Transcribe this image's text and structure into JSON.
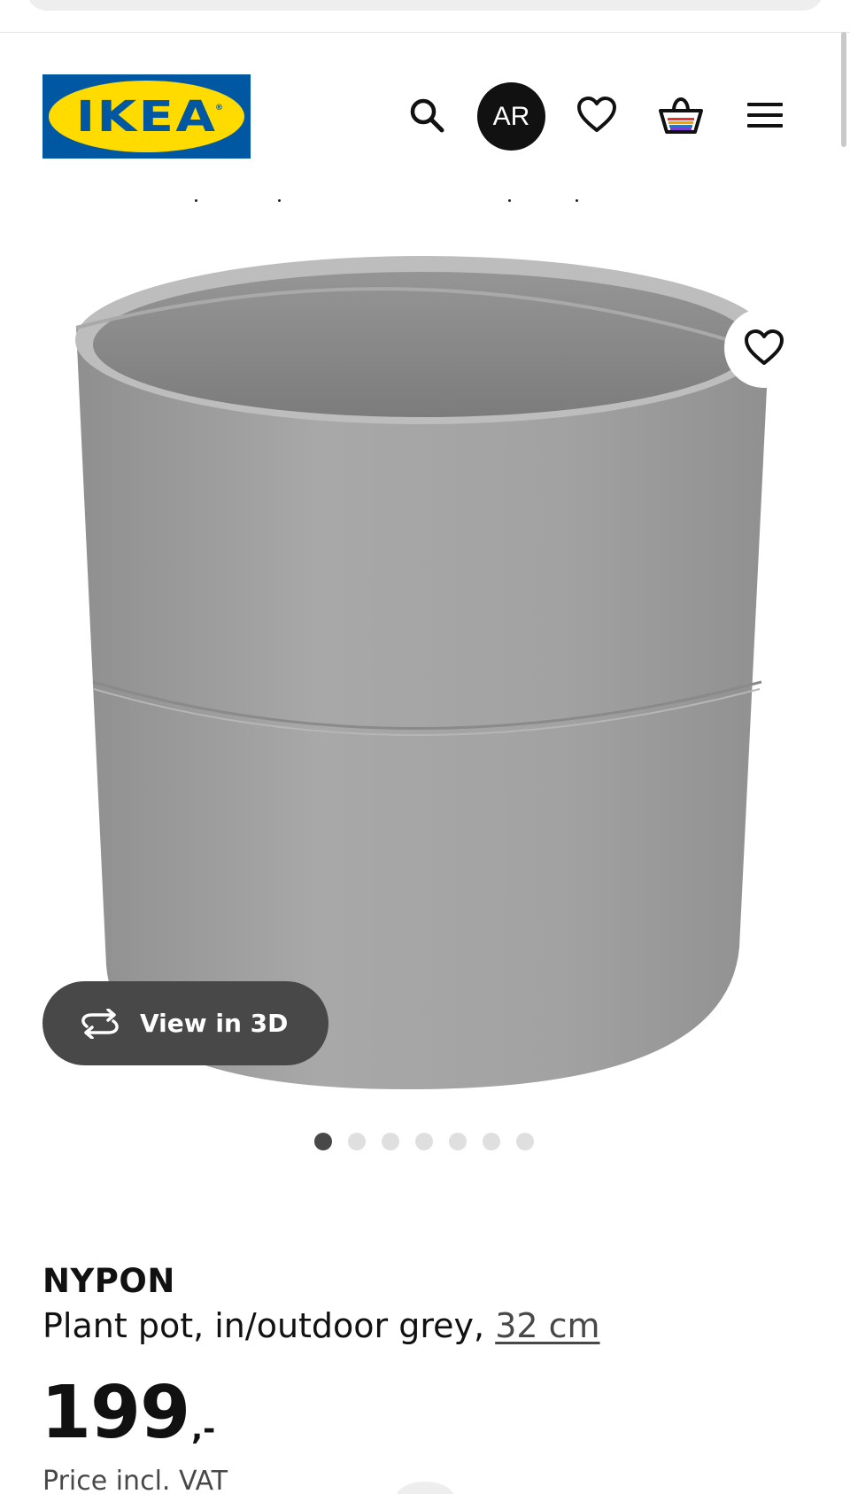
{
  "header": {
    "logo_text": "IKEA",
    "logo_reg": "®",
    "ar_label": "AR",
    "icons": {
      "search": "search-icon",
      "favourites": "heart-icon",
      "cart": "shopping-basket-icon",
      "menu": "hamburger-menu-icon"
    }
  },
  "product_image": {
    "favourite_icon": "heart-icon",
    "view3d_label": "View in 3D",
    "view3d_icon": "rotate-3d-icon",
    "carousel": {
      "total": 7,
      "active": 1
    }
  },
  "product": {
    "name": "NYPON",
    "description": "Plant pot, in/outdoor grey,",
    "size_link": "32 cm",
    "price_integer": "199",
    "price_suffix": ",-",
    "price_note": "Price incl. VAT"
  },
  "colors": {
    "ikea_blue": "#0058a3",
    "ikea_yellow": "#ffdb00",
    "pot_grey": "#9a9a9a",
    "dark_button": "#484848"
  }
}
